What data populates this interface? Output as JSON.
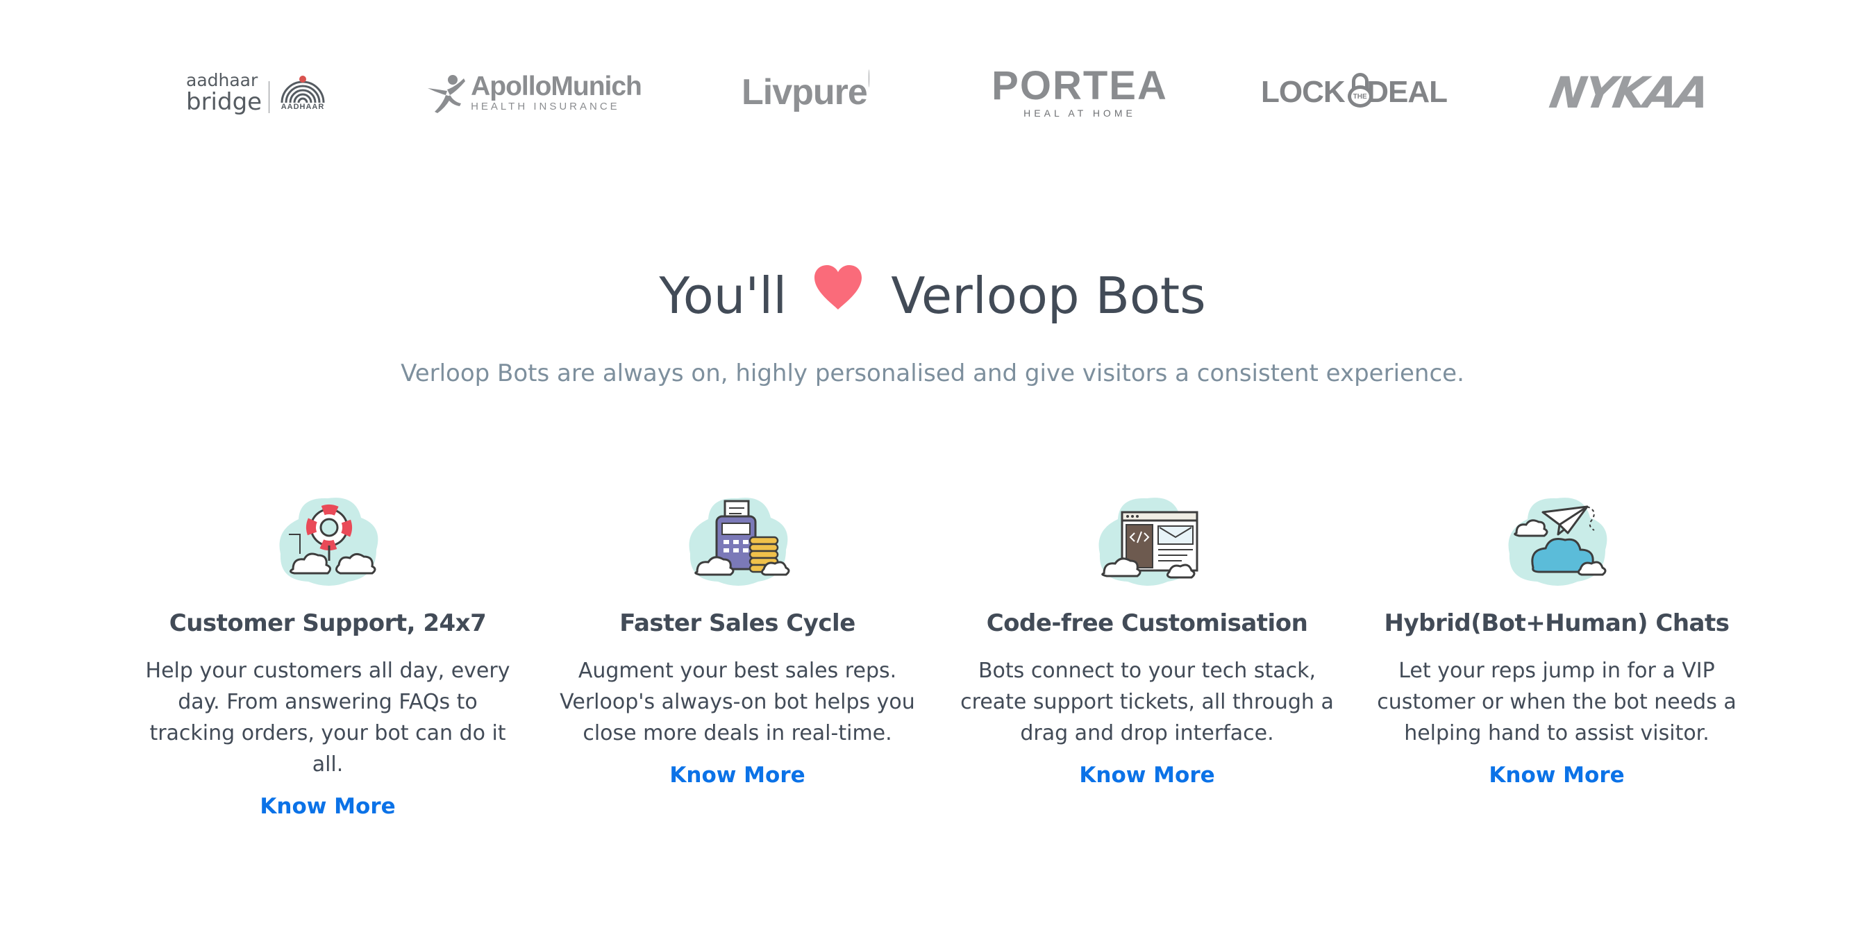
{
  "logos": [
    {
      "name": "aadhaar-bridge",
      "line1": "aadhaar",
      "line2": "bridge",
      "mark_label": "AADHAAR"
    },
    {
      "name": "apollo-munich",
      "name_text": "ApolloMunich",
      "sub_text": "HEALTH INSURANCE"
    },
    {
      "name": "livpure",
      "text": "Livpure"
    },
    {
      "name": "portea",
      "text": "PORTEA",
      "sub_text": "HEAL AT HOME"
    },
    {
      "name": "lock-the-deal",
      "left": "LOCK",
      "middle": "THE",
      "right": "DEAL"
    },
    {
      "name": "nykaa",
      "text": "NYKAA"
    }
  ],
  "heading": {
    "before": "You'll",
    "icon": "heart-icon",
    "after": "Verloop Bots",
    "heart_color": "#fa6b7a"
  },
  "subtitle": "Verloop Bots are always on, highly personalised and give visitors a consistent experience.",
  "features": [
    {
      "icon": "lifebuoy-cloud-icon",
      "title": "Customer Support, 24x7",
      "description": "Help your customers all day, every day. From answering FAQs to tracking orders, your bot can do it all.",
      "link": "Know More"
    },
    {
      "icon": "payment-terminal-coins-icon",
      "title": "Faster Sales Cycle",
      "description": "Augment your best sales reps. Verloop's always-on bot helps you close more deals in real-time.",
      "link": "Know More"
    },
    {
      "icon": "browser-code-icon",
      "title": "Code-free Customisation",
      "description": "Bots connect to your tech stack, create support tickets, all through a drag and drop interface.",
      "link": "Know More"
    },
    {
      "icon": "paper-plane-cloud-icon",
      "title": "Hybrid(Bot+Human) Chats",
      "description": "Let your reps jump in for a VIP customer or when the bot needs a helping hand to assist visitor.",
      "link": "Know More"
    }
  ],
  "colors": {
    "heading": "#424b57",
    "subtitle": "#7d8f9d",
    "link": "#0b72e7",
    "icon_blob": "#c9ece8"
  }
}
